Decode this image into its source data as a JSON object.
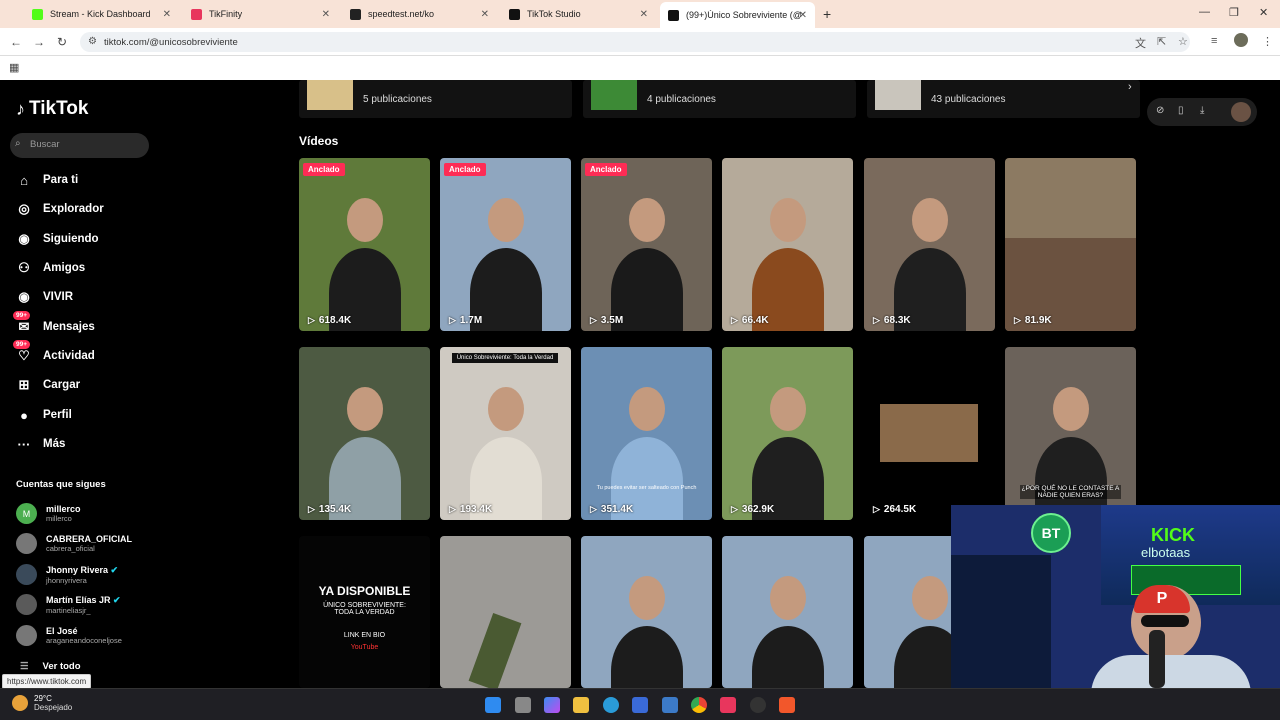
{
  "browser": {
    "tabs": [
      {
        "label": "Stream - Kick Dashboard",
        "color": "#53fc18",
        "active": false
      },
      {
        "label": "TikFinity",
        "color": "#e8365d",
        "active": false
      },
      {
        "label": "speedtest.net/ko",
        "color": "#222222",
        "active": false
      },
      {
        "label": "TikTok Studio",
        "color": "#111111",
        "active": false
      },
      {
        "label": "(99+)Único Sobreviviente (@",
        "color": "#111111",
        "active": true
      }
    ],
    "url": "tiktok.com/@unicosobreviviente"
  },
  "sidebar": {
    "logo": "TikTok",
    "search_placeholder": "Buscar",
    "nav": [
      {
        "label": "Para ti",
        "icon": "home-icon"
      },
      {
        "label": "Explorador",
        "icon": "compass-icon"
      },
      {
        "label": "Siguiendo",
        "icon": "following-icon"
      },
      {
        "label": "Amigos",
        "icon": "friends-icon"
      },
      {
        "label": "VIVIR",
        "icon": "live-icon"
      },
      {
        "label": "Mensajes",
        "icon": "messages-icon",
        "badge": "99+"
      },
      {
        "label": "Actividad",
        "icon": "activity-icon",
        "badge": "99+"
      },
      {
        "label": "Cargar",
        "icon": "upload-icon"
      },
      {
        "label": "Perfil",
        "icon": "profile-icon"
      },
      {
        "label": "Más",
        "icon": "more-icon"
      }
    ],
    "following_title": "Cuentas que sigues",
    "accounts": [
      {
        "name": "millerco",
        "user": "millerco",
        "verified": false,
        "color": "#4caf50",
        "initial": "M"
      },
      {
        "name": "CABRERA_OFICIAL",
        "user": "cabrera_oficial",
        "verified": false,
        "color": "#777777",
        "initial": ""
      },
      {
        "name": "Jhonny Rivera",
        "user": "jhonnyrivera",
        "verified": true,
        "color": "#3a4a5a",
        "initial": ""
      },
      {
        "name": "Martín Elías JR",
        "user": "martineliasjr_",
        "verified": true,
        "color": "#5a5a5a",
        "initial": ""
      },
      {
        "name": "El José",
        "user": "araganeandoconeljose",
        "verified": false,
        "color": "#777777",
        "initial": ""
      }
    ],
    "see_all": "Ver todo"
  },
  "collections": [
    {
      "count": "5 publicaciones",
      "color": "#d8c089"
    },
    {
      "count": "4 publicaciones",
      "color": "#3d8a36"
    },
    {
      "count": "43 publicaciones",
      "color": "#c9c5bc"
    }
  ],
  "videos_heading": "Vídeos",
  "videos": [
    {
      "views": "618.4K",
      "pinned": "Anclado",
      "bg": "#5f7a3a",
      "fg": "#1c1c1c"
    },
    {
      "views": "1.7M",
      "pinned": "Anclado",
      "bg": "#8fa6bf",
      "fg": "#1c1c1c"
    },
    {
      "views": "3.5M",
      "pinned": "Anclado",
      "bg": "#6e6458",
      "fg": "#1a1a1a"
    },
    {
      "views": "66.4K",
      "pinned": "",
      "bg": "#b5aa9a",
      "fg": "#8a4a1e"
    },
    {
      "views": "68.3K",
      "pinned": "",
      "bg": "#7a6a5c",
      "fg": "#1f1f1f"
    },
    {
      "views": "81.9K",
      "pinned": "",
      "bg": "#8c7a62",
      "fg": "#5a4a3a"
    },
    {
      "views": "135.4K",
      "pinned": "",
      "bg": "#4d5a42",
      "fg": "#8fa0a6"
    },
    {
      "views": "193.4K",
      "pinned": "",
      "bg": "#cfcac2",
      "fg": "#e2ddd3"
    },
    {
      "views": "351.4K",
      "pinned": "",
      "bg": "#6c8fb4",
      "fg": "#8fb3d8"
    },
    {
      "views": "362.9K",
      "pinned": "",
      "bg": "#7d9a5a",
      "fg": "#1f1f1f"
    },
    {
      "views": "264.5K",
      "pinned": "",
      "bg": "#000000",
      "fg": "#8a6a4a"
    },
    {
      "views": "",
      "pinned": "",
      "bg": "#6b625a",
      "fg": "#1f1f1f"
    },
    {
      "views": "",
      "pinned": "",
      "bg": "#050505",
      "fg": "#050505"
    },
    {
      "views": "",
      "pinned": "",
      "bg": "#9c9a96",
      "fg": "#4a5a32"
    },
    {
      "views": "",
      "pinned": "",
      "bg": "#8fa6bf",
      "fg": "#1c1c1c"
    },
    {
      "views": "",
      "pinned": "",
      "bg": "#8fa6bf",
      "fg": "#1c1c1c"
    },
    {
      "views": "",
      "pinned": "",
      "bg": "#8fa6bf",
      "fg": "#1c1c1c"
    }
  ],
  "overlays": {
    "v8_top": "Único Sobreviviente: Toda la Verdad",
    "v9_caption": "Tu puedes evitar ser salteado con Punch",
    "v12_caption": "¿POR QUÉ NO LE CONTASTE A NADIE QUIEN ERAS?",
    "v13_title": "YA DISPONIBLE",
    "v13_sub": "ÚNICO SOBREVIVIENTE: TODA LA VERDAD",
    "v13_link": "LINK EN BIO",
    "v13_yt": "YouTube"
  },
  "status_link": "https://www.tiktok.com",
  "webcam": {
    "sign": "KICK",
    "sign2": "elbotaas"
  },
  "taskbar": {
    "temp": "29°C",
    "condition": "Despejado"
  }
}
